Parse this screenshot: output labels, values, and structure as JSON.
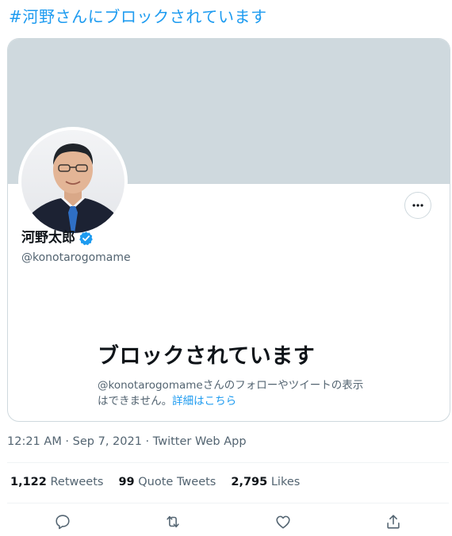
{
  "hashtag": "#河野さんにブロックされています",
  "profile": {
    "display_name": "河野太郎",
    "handle": "@konotarogomame",
    "verified": true
  },
  "blocked": {
    "title": "ブロックされています",
    "description": "@konotarogomameさんのフォローやツイートの表示はできません。",
    "learn_more": "詳細はこちら"
  },
  "tweet_meta": {
    "timestamp": "12:21 AM · Sep 7, 2021 · Twitter Web App"
  },
  "stats": {
    "retweets_count": "1,122",
    "retweets_label": "Retweets",
    "quote_count": "99",
    "quote_label": "Quote Tweets",
    "likes_count": "2,795",
    "likes_label": "Likes"
  },
  "actions": [
    "reply-icon",
    "retweet-icon",
    "like-icon",
    "share-icon"
  ],
  "colors": {
    "accent": "#1d9bf0",
    "banner": "#cfd9de",
    "muted_text": "#536471"
  }
}
